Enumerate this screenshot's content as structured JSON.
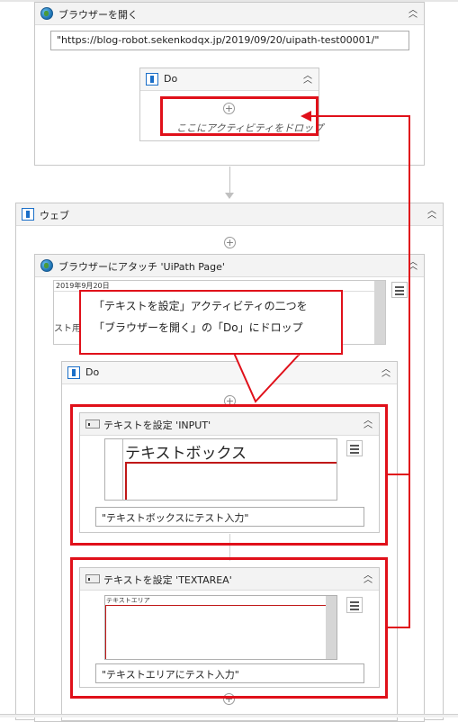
{
  "open_browser": {
    "title": "ブラウザーを開く",
    "url_value": "\"https://blog-robot.sekenkodqx.jp/2019/09/20/uipath-test00001/\"",
    "do": {
      "title": "Do",
      "drop_hint": "ここにアクティビティをドロップ"
    }
  },
  "web": {
    "title": "ウェブ"
  },
  "attach_browser": {
    "title": "ブラウザーにアタッチ 'UiPath    Page'",
    "preview_date": "2019年9月20日",
    "preview_text": "スト用"
  },
  "inner_do": {
    "title": "Do"
  },
  "set_text_input": {
    "title": "テキストを設定 'INPUT'",
    "preview_label": "テキストボックス",
    "value": "\"テキストボックスにテスト入力\""
  },
  "set_text_textarea": {
    "title": "テキストを設定 'TEXTAREA'",
    "preview_label": "テキストエリア",
    "value": "\"テキストエリアにテスト入力\""
  },
  "annotation": {
    "line1": "「テキストを設定」アクティビティの二つを",
    "line2": "「ブラウザーを開く」の「Do」にドロップ"
  },
  "colors": {
    "annotation_red": "#e0101a",
    "accent_blue": "#1b6fc8"
  }
}
